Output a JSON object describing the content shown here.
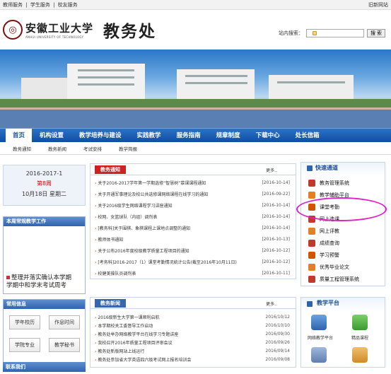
{
  "topbar": {
    "links": [
      "教师服务",
      "学生服务",
      "校友服务"
    ],
    "separator": "|",
    "old_site": "旧新网站"
  },
  "header": {
    "school_cn": "安徽工业大学",
    "school_en": "ANHUI UNIVERSITY OF TECHNOLOGY",
    "office": "教务处",
    "search_label": "站内搜索：",
    "search_button": "搜 索"
  },
  "nav": {
    "items": [
      "首页",
      "机构设置",
      "教学培养与建设",
      "实践教学",
      "服务指南",
      "规章制度",
      "下载中心",
      "处长信箱"
    ],
    "active_index": 0
  },
  "subnav": {
    "items": [
      "教务通知",
      "教务新闻",
      "考试安排",
      "教学简报"
    ]
  },
  "date": {
    "term": "2016-2017-1",
    "week": "第8周",
    "day": "10月18日 星期二"
  },
  "focus": {
    "title": "本周常规教学工作",
    "text_line1": "整理并落实确认本学期",
    "text_line2": "学期中和学末考试周考"
  },
  "info": {
    "title": "常用信息",
    "buttons": [
      "学年校历",
      "作息时间",
      "学院专业",
      "教学秘书"
    ]
  },
  "contact": {
    "title": "联系我们"
  },
  "notices": {
    "title": "教务通知",
    "more": "更多..",
    "items": [
      {
        "title": "关于2016-2017学年第一学期选修“智慧树”慕课课程通知",
        "date": "[2016-10-14]"
      },
      {
        "title": "关于开通军事理论及校公共选修课网络课程在线学习的通知",
        "date": "[2016-09-22]"
      },
      {
        "title": "关于2016级学生网络课程学习讲座通知",
        "date": "[2016-10-14]"
      },
      {
        "title": "校网、女篮球队（内组）调剂表",
        "date": "[2016-10-14]"
      },
      {
        "title": "[教务科]关于围棋、象棋课程上课地点调整的通知",
        "date": "[2016-10-14]"
      },
      {
        "title": "教师体书通知",
        "date": "[2016-10-13]"
      },
      {
        "title": "关于公布2016年度校级教学质量工程项目的通知",
        "date": "[2016-10-12]"
      },
      {
        "title": "[考务科]2016-2017（1）课堂考勤情况统计公告(截至2016年10月11日)",
        "date": "[2016-10-12]"
      },
      {
        "title": "校健美操队员调剂表",
        "date": "[2016-10-11]"
      }
    ]
  },
  "news": {
    "title": "教务新闻",
    "more": "更多..",
    "items": [
      {
        "title": "2016级新生大学第一课顺利启航",
        "date": "2016/10/12"
      },
      {
        "title": "本学期校关工委督导工作启动",
        "date": "2016/10/10"
      },
      {
        "title": "教务处举办网络教学平台在线学习专题讲座",
        "date": "2016/09/30"
      },
      {
        "title": "我校召开2016年质量工程项目评审会议",
        "date": "2016/09/26"
      },
      {
        "title": "教务处新版网站上线运行",
        "date": "2016/09/14"
      },
      {
        "title": "教务处参加省大学英语四六级考试网上报名培训会",
        "date": "2016/09/08"
      }
    ]
  },
  "quick": {
    "title": "快速通道",
    "items": [
      {
        "label": "教务管理系统",
        "color": "#c0392b"
      },
      {
        "label": "教学辅助平台",
        "color": "#e67e22"
      },
      {
        "label": "课堂考勤",
        "color": "#d35400"
      },
      {
        "label": "网上选课",
        "color": "#c0392b"
      },
      {
        "label": "网上评教",
        "color": "#e67e22"
      },
      {
        "label": "成绩查询",
        "color": "#c0392b"
      },
      {
        "label": "学习预警",
        "color": "#d35400"
      },
      {
        "label": "优秀毕业论文",
        "color": "#e67e22"
      },
      {
        "label": "质量工程管理系统",
        "color": "#c0392b"
      }
    ]
  },
  "teach": {
    "title": "教学平台",
    "items": [
      "网络教学平台",
      "精品课程"
    ]
  },
  "colors": {
    "nav_blue": "#1b56a8",
    "notice_red": "#cc2222",
    "highlight_magenta": "#e020c8"
  }
}
